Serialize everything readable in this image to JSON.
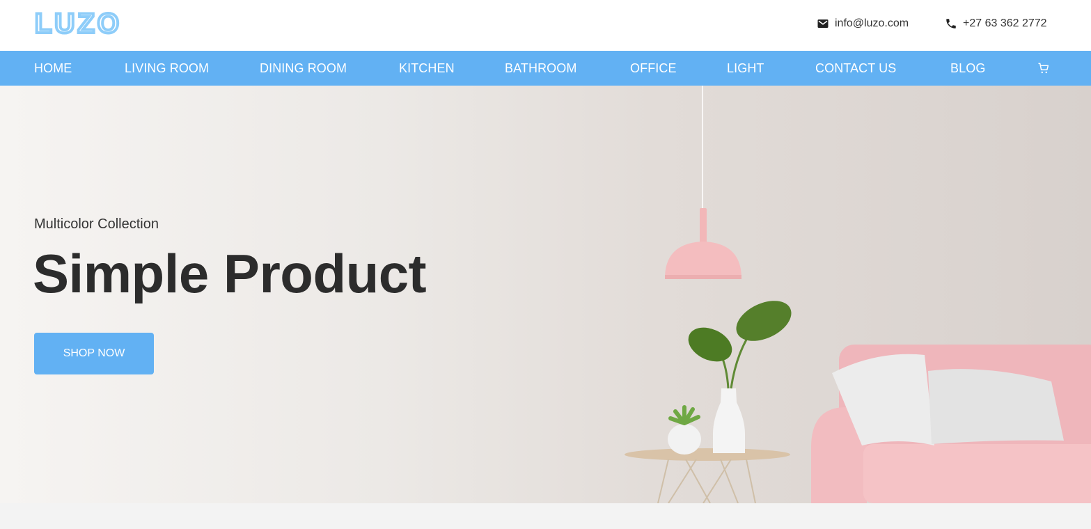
{
  "brand": {
    "logo_text": "LUZO",
    "logo_color": "#8ecdf9",
    "accent": "#62b1f3"
  },
  "header": {
    "email": "info@luzo.com",
    "phone": "+27 63 362 2772",
    "email_icon": "envelope-icon",
    "phone_icon": "phone-icon"
  },
  "nav": {
    "items": [
      {
        "label": "HOME"
      },
      {
        "label": "LIVING ROOM"
      },
      {
        "label": "DINING ROOM"
      },
      {
        "label": "KITCHEN"
      },
      {
        "label": "BATHROOM"
      },
      {
        "label": "OFFICE"
      },
      {
        "label": "LIGHT"
      },
      {
        "label": "CONTACT US"
      },
      {
        "label": "BLOG"
      }
    ],
    "cart_icon": "cart-icon"
  },
  "hero": {
    "subtitle": "Multicolor Collection",
    "headline": "Simple Product",
    "button_label": "SHOP NOW"
  }
}
